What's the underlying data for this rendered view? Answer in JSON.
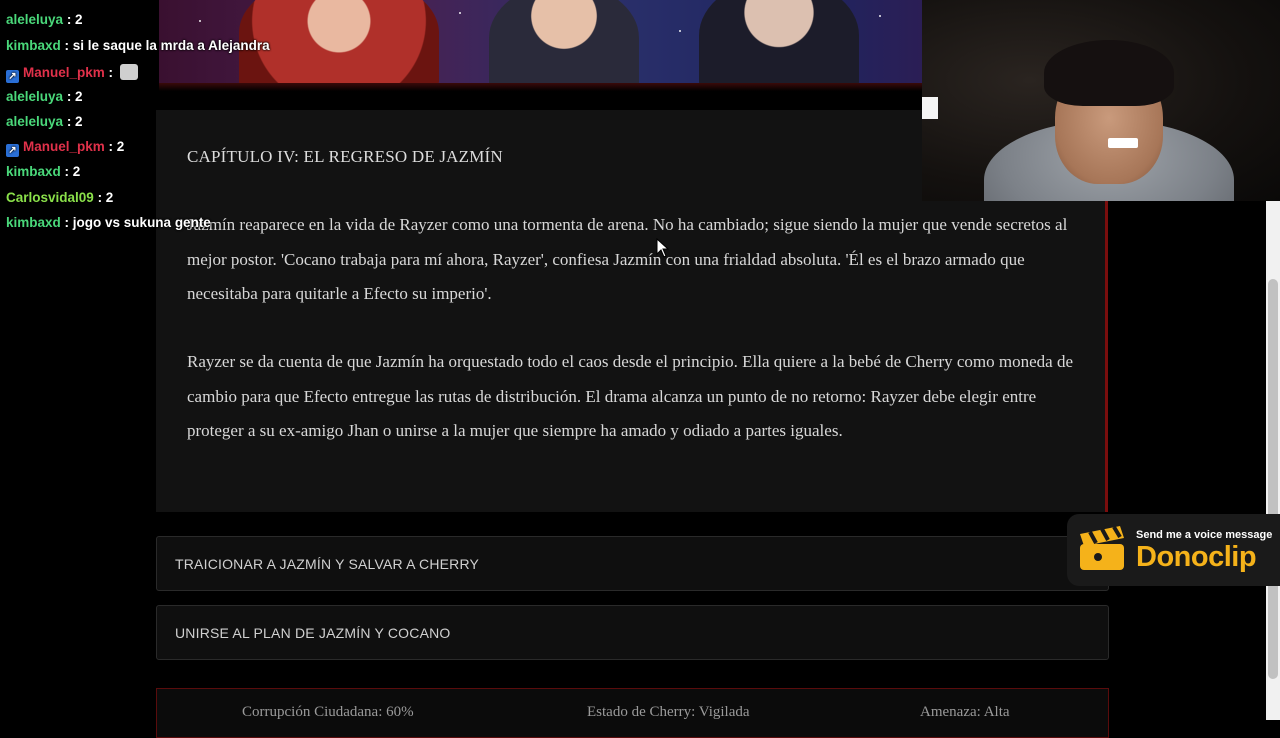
{
  "story": {
    "chapter_title": "CAPÍTULO IV: EL REGRESO DE JAZMÍN",
    "paragraph_1": "Jazmín reaparece en la vida de Rayzer como una tormenta de arena. No ha cambiado; sigue siendo la mujer que vende secretos al mejor postor. 'Cocano trabaja para mí ahora, Rayzer', confiesa Jazmín con una frialdad absoluta. 'Él es el brazo armado que necesitaba para quitarle a Efecto su imperio'.",
    "paragraph_2": "Rayzer se da cuenta de que Jazmín ha orquestado todo el caos desde el principio. Ella quiere a la bebé de Cherry como moneda de cambio para que Efecto entregue las rutas de distribución. El drama alcanza un punto de no retorno: Rayzer debe elegir entre proteger a su ex-amigo Jhan o unirse a la mujer que siempre ha amado y odiado a partes iguales."
  },
  "choices": [
    {
      "label": "TRAICIONAR A JAZMÍN Y SALVAR A CHERRY"
    },
    {
      "label": "UNIRSE AL PLAN DE JAZMÍN Y COCANO"
    }
  ],
  "status": {
    "corruption": "Corrupción Ciudadana: 60%",
    "cherry": "Estado de Cherry: Vigilada",
    "threat": "Amenaza: Alta"
  },
  "chat": [
    {
      "user": "aleleluya",
      "msg": ": 2",
      "color": "green"
    },
    {
      "user": "kimbaxd",
      "msg": ": si le saque la mrda a Alejandra",
      "color": "green"
    },
    {
      "user": "Manuel_pkm",
      "msg": ":",
      "color": "red",
      "badge": true,
      "emote": true
    },
    {
      "user": "aleleluya",
      "msg": ": 2",
      "color": "green"
    },
    {
      "user": "aleleluya",
      "msg": ": 2",
      "color": "green"
    },
    {
      "user": "Manuel_pkm",
      "msg": ": 2",
      "color": "red",
      "badge": true
    },
    {
      "user": "kimbaxd",
      "msg": ": 2",
      "color": "green"
    },
    {
      "user": "Carlosvidal09",
      "msg": ": 2",
      "color": "lime"
    },
    {
      "user": "kimbaxd",
      "msg": ": jogo vs sukuna gente",
      "color": "green"
    }
  ],
  "donoclip": {
    "cta": "Send me a voice message",
    "brand": "Donoclip",
    "brand_color": "#f5b21a"
  },
  "colors": {
    "accent_red": "#7a0d0d",
    "card_bg": "#121212"
  }
}
